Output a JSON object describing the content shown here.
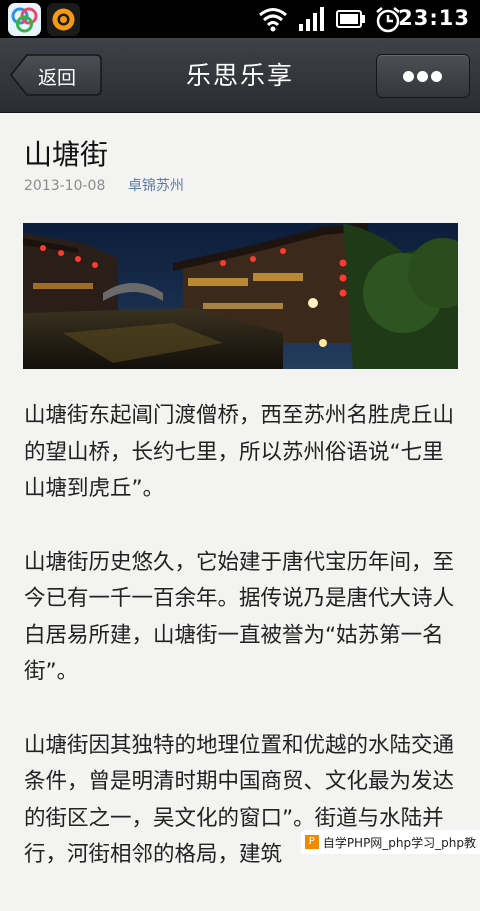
{
  "status_bar": {
    "time": "23:13"
  },
  "header": {
    "back_label": "返回",
    "title": "乐思乐享"
  },
  "article": {
    "title": "山塘街",
    "date": "2013-10-08",
    "author": "卓锦苏州",
    "paragraphs": [
      "山塘街东起阊门渡僧桥，西至苏州名胜虎丘山的望山桥，长约七里，所以苏州俗语说“七里山塘到虎丘”。",
      "山塘街历史悠久，它始建于唐代宝历年间，至今已有一千一百余年。据传说乃是唐代大诗人白居易所建，山塘街一直被誉为“姑苏第一名街”。",
      "山塘街因其独特的地理位置和优越的水陆交通条件，曾是明清时期中国商贸、文化最为发达的街区之一，吴文化的窗口”。街道与水陆并行，河街相邻的格局，建筑"
    ]
  },
  "watermark": {
    "text": "自学PHP网_php学习_php教"
  }
}
